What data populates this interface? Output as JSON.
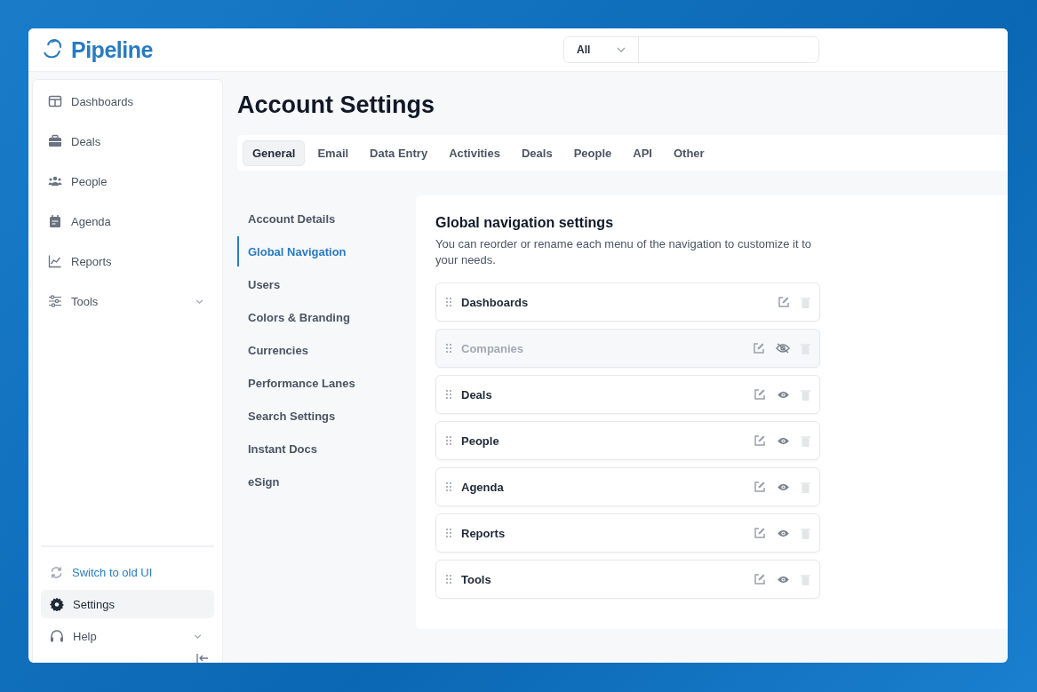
{
  "header": {
    "logo": "Pipeline",
    "search": {
      "scope": "All"
    }
  },
  "sidebar": {
    "items": [
      {
        "label": "Dashboards",
        "expandable": false
      },
      {
        "label": "Deals",
        "expandable": false
      },
      {
        "label": "People",
        "expandable": false
      },
      {
        "label": "Agenda",
        "expandable": false
      },
      {
        "label": "Reports",
        "expandable": false
      },
      {
        "label": "Tools",
        "expandable": true
      }
    ],
    "bottom": [
      {
        "label": "Switch to old UI",
        "kind": "link",
        "selected": false,
        "expandable": false
      },
      {
        "label": "Settings",
        "kind": "item",
        "selected": true,
        "expandable": false
      },
      {
        "label": "Help",
        "kind": "item",
        "selected": false,
        "expandable": true
      }
    ]
  },
  "page": {
    "title": "Account Settings"
  },
  "tabs": [
    {
      "label": "General",
      "selected": true
    },
    {
      "label": "Email",
      "selected": false
    },
    {
      "label": "Data Entry",
      "selected": false
    },
    {
      "label": "Activities",
      "selected": false
    },
    {
      "label": "Deals",
      "selected": false
    },
    {
      "label": "People",
      "selected": false
    },
    {
      "label": "API",
      "selected": false
    },
    {
      "label": "Other",
      "selected": false
    }
  ],
  "subnav": [
    {
      "label": "Account Details",
      "selected": false
    },
    {
      "label": "Global Navigation",
      "selected": true
    },
    {
      "label": "Users",
      "selected": false
    },
    {
      "label": "Colors & Branding",
      "selected": false
    },
    {
      "label": "Currencies",
      "selected": false
    },
    {
      "label": "Performance Lanes",
      "selected": false
    },
    {
      "label": "Search Settings",
      "selected": false
    },
    {
      "label": "Instant Docs",
      "selected": false
    },
    {
      "label": "eSign",
      "selected": false
    }
  ],
  "panel": {
    "title": "Global navigation settings",
    "description": "You can reorder or rename each menu of the navigation to customize it to your needs.",
    "menus": [
      {
        "label": "Dashboards",
        "hideable": false,
        "hidden": false
      },
      {
        "label": "Companies",
        "hideable": true,
        "hidden": true
      },
      {
        "label": "Deals",
        "hideable": true,
        "hidden": false
      },
      {
        "label": "People",
        "hideable": true,
        "hidden": false
      },
      {
        "label": "Agenda",
        "hideable": true,
        "hidden": false
      },
      {
        "label": "Reports",
        "hideable": true,
        "hidden": false
      },
      {
        "label": "Tools",
        "hideable": true,
        "hidden": false
      }
    ]
  }
}
